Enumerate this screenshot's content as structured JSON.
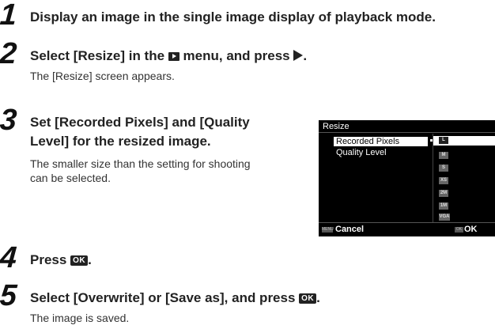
{
  "steps": [
    {
      "number": "1",
      "title": "Display an image in the single image display of playback mode."
    },
    {
      "number": "2",
      "title_before": "Select [Resize] in the",
      "title_after": "menu, and press",
      "title_end": ".",
      "description": "The [Resize] screen appears."
    },
    {
      "number": "3",
      "title_line1": "Set [Recorded Pixels] and [Quality",
      "title_line2": "Level] for the resized image.",
      "description_line1": "The smaller size than the setting for shooting",
      "description_line2": "can be selected."
    },
    {
      "number": "4",
      "title": "Press",
      "title_end": "."
    },
    {
      "number": "5",
      "title": "Select [Overwrite] or [Save as], and press",
      "title_end": ".",
      "description": "The image is saved."
    }
  ],
  "ok_key_label": "OK",
  "screen": {
    "title": "Resize",
    "items": [
      "Recorded Pixels",
      "Quality Level"
    ],
    "size_options": [
      "L",
      "M",
      "S",
      "XS",
      "2M",
      "1M",
      "VGA"
    ],
    "selected_option": "L",
    "menu_key": "MENU",
    "cancel_label": "Cancel",
    "ok_key": "OK",
    "ok_label": "OK"
  }
}
